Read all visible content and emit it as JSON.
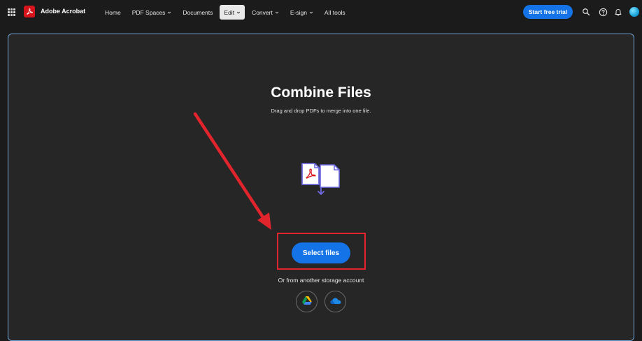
{
  "header": {
    "app_title": "Adobe Acrobat",
    "nav": [
      {
        "label": "Home",
        "has_menu": false,
        "active": false
      },
      {
        "label": "PDF Spaces",
        "has_menu": true,
        "active": false
      },
      {
        "label": "Documents",
        "has_menu": false,
        "active": false
      },
      {
        "label": "Edit",
        "has_menu": true,
        "active": true
      },
      {
        "label": "Convert",
        "has_menu": true,
        "active": false
      },
      {
        "label": "E-sign",
        "has_menu": true,
        "active": false
      },
      {
        "label": "All tools",
        "has_menu": false,
        "active": false
      }
    ],
    "trial_label": "Start free trial",
    "icons": [
      "apps-grid-icon",
      "acrobat-logo-icon",
      "search-icon",
      "help-icon",
      "notification-bell-icon",
      "user-avatar"
    ]
  },
  "main": {
    "title": "Combine Files",
    "subtitle": "Drag and drop PDFs to merge into one file.",
    "select_label": "Select files",
    "storage_label": "Or from another storage account",
    "storage_options": [
      "google-drive-icon",
      "onedrive-icon"
    ]
  },
  "colors": {
    "background": "#1b1b1b",
    "panel": "#262626",
    "panel_border": "#6fa3d6",
    "accent": "#1473e6",
    "annotation": "#e2242c",
    "brand": "#d7141c"
  }
}
